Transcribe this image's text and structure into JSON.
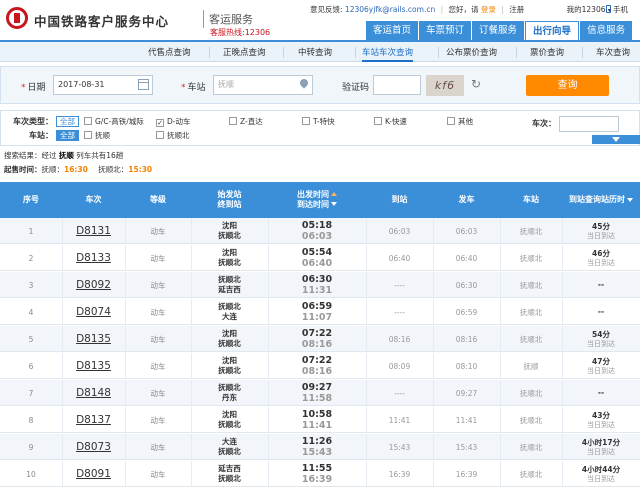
{
  "header": {
    "logo_text": "中国铁路客户服务中心",
    "sub_title": "客运服务",
    "hotline": "客服热线:12306",
    "links": {
      "feedback": "意见反馈:",
      "email": "12306yjfk@rails.com.cn",
      "greeting": "您好，请",
      "login": "登录",
      "register": "注册",
      "my12306": "我的12306",
      "mobile": "手机"
    },
    "main_nav": [
      "客运首页",
      "车票预订",
      "订餐服务",
      "出行向导",
      "信息服务"
    ],
    "main_nav_active": "出行向导"
  },
  "subnav": {
    "items": [
      "代售点查询",
      "正晚点查询",
      "中转查询",
      "车站车次查询",
      "公布票价查询",
      "票价查询",
      "车次查询"
    ],
    "active": "车站车次查询"
  },
  "query": {
    "date_label": "日期",
    "date_value": "2017-08-31",
    "station_label": "车站",
    "station_value": "抚顺",
    "captcha_label": "验证码",
    "captcha_text": "kf6",
    "query_button": "查询"
  },
  "filter": {
    "type_label": "车次类型：",
    "all_label": "全部",
    "types": [
      {
        "label": "G/C-高铁/城际",
        "checked": false
      },
      {
        "label": "D-动车",
        "checked": true
      },
      {
        "label": "Z-直达",
        "checked": false
      },
      {
        "label": "T-特快",
        "checked": false
      },
      {
        "label": "K-快速",
        "checked": false
      },
      {
        "label": "其他",
        "checked": false
      }
    ],
    "train_label": "车次：",
    "station_label": "车站：",
    "stations": [
      {
        "label": "抚顺",
        "checked": false
      },
      {
        "label": "抚顺北",
        "checked": false
      }
    ]
  },
  "summary": {
    "prefix": "搜索结果：经过",
    "station": "抚顺",
    "suffix": "列车共有16趟"
  },
  "timeline": {
    "label": "起售时间：",
    "s1": "抚顺：",
    "t1": "16:30",
    "s2": "抚顺北：",
    "t2": "15:30"
  },
  "table": {
    "headers": {
      "idx": "序号",
      "train": "车次",
      "grade": "等级",
      "stations": [
        "始发站",
        "终到站"
      ],
      "times": [
        "出发时间",
        "到达时间"
      ],
      "arrive": "到站",
      "depart": "发车",
      "station": "车站",
      "duration": "到站查询站历时"
    },
    "rows": [
      {
        "idx": "1",
        "train": "D8131",
        "grade": "动车",
        "from": "沈阳",
        "to": "抚顺北",
        "dep": "05:18",
        "arr": "06:03",
        "arrive": "06:03",
        "depart": "06:03",
        "station": "抚顺北",
        "dur": "45分",
        "day": "当日到达"
      },
      {
        "idx": "2",
        "train": "D8133",
        "grade": "动车",
        "from": "沈阳",
        "to": "抚顺北",
        "dep": "05:54",
        "arr": "06:40",
        "arrive": "06:40",
        "depart": "06:40",
        "station": "抚顺北",
        "dur": "46分",
        "day": "当日到达"
      },
      {
        "idx": "3",
        "train": "D8092",
        "grade": "动车",
        "from": "抚顺北",
        "to": "延吉西",
        "dep": "06:30",
        "arr": "11:31",
        "arrive": "----",
        "depart": "06:30",
        "station": "抚顺北",
        "dur": "--",
        "day": ""
      },
      {
        "idx": "4",
        "train": "D8074",
        "grade": "动车",
        "from": "抚顺北",
        "to": "大连",
        "dep": "06:59",
        "arr": "11:07",
        "arrive": "----",
        "depart": "06:59",
        "station": "抚顺北",
        "dur": "--",
        "day": ""
      },
      {
        "idx": "5",
        "train": "D8135",
        "grade": "动车",
        "from": "沈阳",
        "to": "抚顺北",
        "dep": "07:22",
        "arr": "08:16",
        "arrive": "08:16",
        "depart": "08:16",
        "station": "抚顺北",
        "dur": "54分",
        "day": "当日到达"
      },
      {
        "idx": "6",
        "train": "D8135",
        "grade": "动车",
        "from": "沈阳",
        "to": "抚顺北",
        "dep": "07:22",
        "arr": "08:16",
        "arrive": "08:09",
        "depart": "08:10",
        "station": "抚顺",
        "dur": "47分",
        "day": "当日到达"
      },
      {
        "idx": "7",
        "train": "D8148",
        "grade": "动车",
        "from": "抚顺北",
        "to": "丹东",
        "dep": "09:27",
        "arr": "11:58",
        "arrive": "----",
        "depart": "09:27",
        "station": "抚顺北",
        "dur": "--",
        "day": ""
      },
      {
        "idx": "8",
        "train": "D8137",
        "grade": "动车",
        "from": "沈阳",
        "to": "抚顺北",
        "dep": "10:58",
        "arr": "11:41",
        "arrive": "11:41",
        "depart": "11:41",
        "station": "抚顺北",
        "dur": "43分",
        "day": "当日到达"
      },
      {
        "idx": "9",
        "train": "D8073",
        "grade": "动车",
        "from": "大连",
        "to": "抚顺北",
        "dep": "11:26",
        "arr": "15:43",
        "arrive": "15:43",
        "depart": "15:43",
        "station": "抚顺北",
        "dur": "4小时17分",
        "day": "当日到达"
      },
      {
        "idx": "10",
        "train": "D8091",
        "grade": "动车",
        "from": "延吉西",
        "to": "抚顺北",
        "dep": "11:55",
        "arr": "16:39",
        "arrive": "16:39",
        "depart": "16:39",
        "station": "抚顺北",
        "dur": "4小时44分",
        "day": "当日到达"
      }
    ]
  }
}
